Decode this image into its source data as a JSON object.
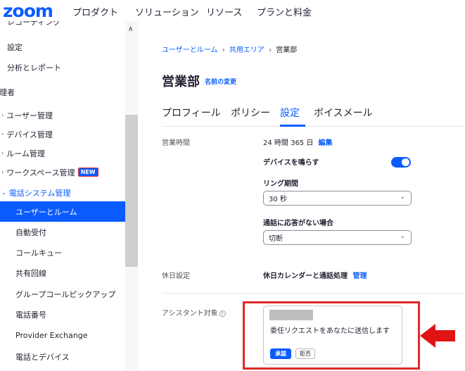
{
  "brand": {
    "logo": "zoom"
  },
  "nav": [
    {
      "label": "プロダクト"
    },
    {
      "label": "ソリューション"
    },
    {
      "label": "リソース"
    },
    {
      "label": "プランと料金"
    }
  ],
  "sidebar": {
    "items": [
      {
        "label": "レコーディング"
      },
      {
        "label": "設定"
      },
      {
        "label": "分析とレポート"
      },
      {
        "label": "管理者"
      },
      {
        "label": "ユーザー管理"
      },
      {
        "label": "デバイス管理"
      },
      {
        "label": "ルーム管理"
      },
      {
        "label": "ワークスペース管理",
        "badge": "NEW"
      },
      {
        "label": "電話システム管理"
      },
      {
        "label": "ユーザーとルーム"
      },
      {
        "label": "自動受付"
      },
      {
        "label": "コールキュー"
      },
      {
        "label": "共有回線"
      },
      {
        "label": "グループコールピックアップ"
      },
      {
        "label": "電話番号"
      },
      {
        "label": "Provider Exchange"
      },
      {
        "label": "電話とデバイス"
      }
    ]
  },
  "breadcrumb": {
    "items": [
      "ユーザーとルーム",
      "共用エリア",
      "営業部"
    ],
    "separator": "›"
  },
  "page": {
    "title": "営業部",
    "rename_link": "名前の変更"
  },
  "tabs": [
    {
      "label": "プロフィール"
    },
    {
      "label": "ポリシー"
    },
    {
      "label": "設定"
    },
    {
      "label": "ボイスメール"
    }
  ],
  "settings": {
    "business_hours": {
      "label": "営業時間",
      "value": "24 時間 365 日",
      "edit_link": "編集",
      "ring_devices_label": "デバイスを鳴らす",
      "ring_devices_on": true,
      "ring_duration_label": "リング期間",
      "ring_duration_value": "30 秒",
      "no_answer_label": "通話に応答がない場合",
      "no_answer_value": "切断"
    },
    "holiday": {
      "label": "休日設定",
      "value": "休日カレンダーと通話処理",
      "manage_link": "管理"
    },
    "assistant": {
      "label": "アシスタント対象",
      "request_text": "委任リクエストをあなたに送信します",
      "accept_label": "承認",
      "reject_label": "拒否"
    }
  },
  "colors": {
    "accent": "#0b5cff",
    "highlight": "#e02828",
    "text": "#232333"
  }
}
